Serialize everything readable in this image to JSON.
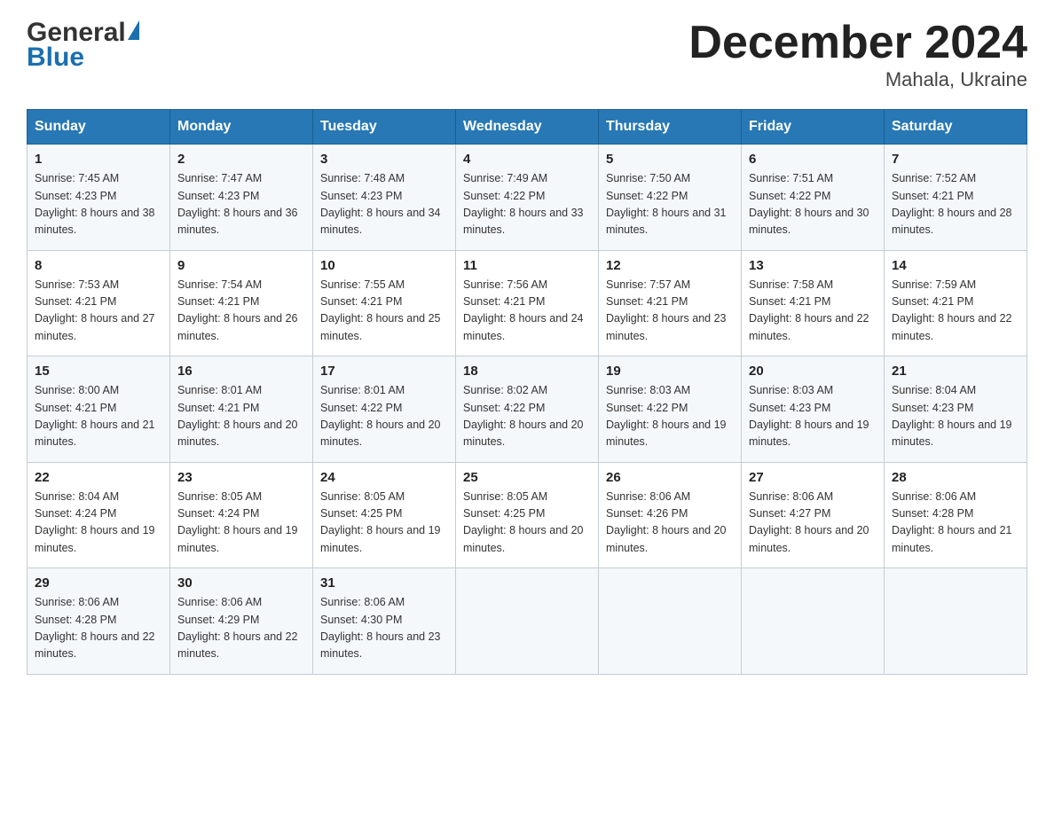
{
  "header": {
    "logo_general": "General",
    "logo_blue": "Blue",
    "title": "December 2024",
    "subtitle": "Mahala, Ukraine"
  },
  "calendar": {
    "days_of_week": [
      "Sunday",
      "Monday",
      "Tuesday",
      "Wednesday",
      "Thursday",
      "Friday",
      "Saturday"
    ],
    "weeks": [
      [
        {
          "day": "1",
          "sunrise": "7:45 AM",
          "sunset": "4:23 PM",
          "daylight": "8 hours and 38 minutes."
        },
        {
          "day": "2",
          "sunrise": "7:47 AM",
          "sunset": "4:23 PM",
          "daylight": "8 hours and 36 minutes."
        },
        {
          "day": "3",
          "sunrise": "7:48 AM",
          "sunset": "4:23 PM",
          "daylight": "8 hours and 34 minutes."
        },
        {
          "day": "4",
          "sunrise": "7:49 AM",
          "sunset": "4:22 PM",
          "daylight": "8 hours and 33 minutes."
        },
        {
          "day": "5",
          "sunrise": "7:50 AM",
          "sunset": "4:22 PM",
          "daylight": "8 hours and 31 minutes."
        },
        {
          "day": "6",
          "sunrise": "7:51 AM",
          "sunset": "4:22 PM",
          "daylight": "8 hours and 30 minutes."
        },
        {
          "day": "7",
          "sunrise": "7:52 AM",
          "sunset": "4:21 PM",
          "daylight": "8 hours and 28 minutes."
        }
      ],
      [
        {
          "day": "8",
          "sunrise": "7:53 AM",
          "sunset": "4:21 PM",
          "daylight": "8 hours and 27 minutes."
        },
        {
          "day": "9",
          "sunrise": "7:54 AM",
          "sunset": "4:21 PM",
          "daylight": "8 hours and 26 minutes."
        },
        {
          "day": "10",
          "sunrise": "7:55 AM",
          "sunset": "4:21 PM",
          "daylight": "8 hours and 25 minutes."
        },
        {
          "day": "11",
          "sunrise": "7:56 AM",
          "sunset": "4:21 PM",
          "daylight": "8 hours and 24 minutes."
        },
        {
          "day": "12",
          "sunrise": "7:57 AM",
          "sunset": "4:21 PM",
          "daylight": "8 hours and 23 minutes."
        },
        {
          "day": "13",
          "sunrise": "7:58 AM",
          "sunset": "4:21 PM",
          "daylight": "8 hours and 22 minutes."
        },
        {
          "day": "14",
          "sunrise": "7:59 AM",
          "sunset": "4:21 PM",
          "daylight": "8 hours and 22 minutes."
        }
      ],
      [
        {
          "day": "15",
          "sunrise": "8:00 AM",
          "sunset": "4:21 PM",
          "daylight": "8 hours and 21 minutes."
        },
        {
          "day": "16",
          "sunrise": "8:01 AM",
          "sunset": "4:21 PM",
          "daylight": "8 hours and 20 minutes."
        },
        {
          "day": "17",
          "sunrise": "8:01 AM",
          "sunset": "4:22 PM",
          "daylight": "8 hours and 20 minutes."
        },
        {
          "day": "18",
          "sunrise": "8:02 AM",
          "sunset": "4:22 PM",
          "daylight": "8 hours and 20 minutes."
        },
        {
          "day": "19",
          "sunrise": "8:03 AM",
          "sunset": "4:22 PM",
          "daylight": "8 hours and 19 minutes."
        },
        {
          "day": "20",
          "sunrise": "8:03 AM",
          "sunset": "4:23 PM",
          "daylight": "8 hours and 19 minutes."
        },
        {
          "day": "21",
          "sunrise": "8:04 AM",
          "sunset": "4:23 PM",
          "daylight": "8 hours and 19 minutes."
        }
      ],
      [
        {
          "day": "22",
          "sunrise": "8:04 AM",
          "sunset": "4:24 PM",
          "daylight": "8 hours and 19 minutes."
        },
        {
          "day": "23",
          "sunrise": "8:05 AM",
          "sunset": "4:24 PM",
          "daylight": "8 hours and 19 minutes."
        },
        {
          "day": "24",
          "sunrise": "8:05 AM",
          "sunset": "4:25 PM",
          "daylight": "8 hours and 19 minutes."
        },
        {
          "day": "25",
          "sunrise": "8:05 AM",
          "sunset": "4:25 PM",
          "daylight": "8 hours and 20 minutes."
        },
        {
          "day": "26",
          "sunrise": "8:06 AM",
          "sunset": "4:26 PM",
          "daylight": "8 hours and 20 minutes."
        },
        {
          "day": "27",
          "sunrise": "8:06 AM",
          "sunset": "4:27 PM",
          "daylight": "8 hours and 20 minutes."
        },
        {
          "day": "28",
          "sunrise": "8:06 AM",
          "sunset": "4:28 PM",
          "daylight": "8 hours and 21 minutes."
        }
      ],
      [
        {
          "day": "29",
          "sunrise": "8:06 AM",
          "sunset": "4:28 PM",
          "daylight": "8 hours and 22 minutes."
        },
        {
          "day": "30",
          "sunrise": "8:06 AM",
          "sunset": "4:29 PM",
          "daylight": "8 hours and 22 minutes."
        },
        {
          "day": "31",
          "sunrise": "8:06 AM",
          "sunset": "4:30 PM",
          "daylight": "8 hours and 23 minutes."
        },
        null,
        null,
        null,
        null
      ]
    ]
  }
}
